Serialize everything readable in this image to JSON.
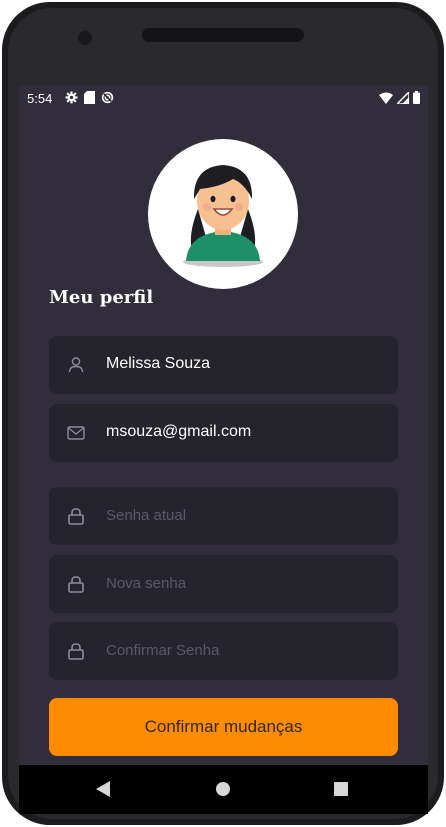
{
  "status_bar": {
    "time": "5:54",
    "left_icons": [
      "gear-icon",
      "sd-card-icon",
      "sync-icon"
    ],
    "right_icons": [
      "wifi-icon",
      "signal-icon",
      "battery-icon"
    ]
  },
  "profile": {
    "title": "Meu perfil",
    "avatar": "avatar-girl-illustration"
  },
  "fields": {
    "name": {
      "value": "Melissa Souza",
      "icon": "user-icon"
    },
    "email": {
      "value": "msouza@gmail.com",
      "icon": "mail-icon"
    },
    "current_password": {
      "placeholder": "Senha atual",
      "icon": "lock-icon"
    },
    "new_password": {
      "placeholder": "Nova senha",
      "icon": "lock-icon"
    },
    "confirm_password": {
      "placeholder": "Confirmar Senha",
      "icon": "lock-icon"
    }
  },
  "confirm_button": {
    "label": "Confirmar mudanças",
    "color": "#ff8c00"
  },
  "nav_bar": {
    "icons": [
      "back-icon",
      "home-icon",
      "recents-icon"
    ]
  },
  "colors": {
    "background": "#312d3a",
    "field": "#25232c",
    "accent": "#ff8c00"
  }
}
